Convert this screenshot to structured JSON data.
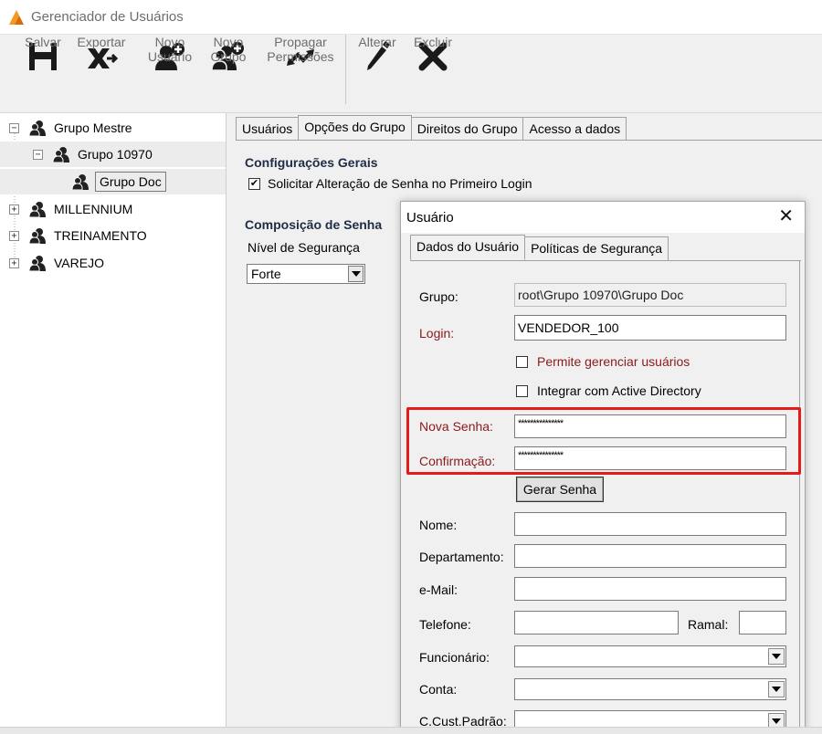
{
  "window": {
    "title": "Gerenciador de Usuários"
  },
  "toolbar": {
    "buttons": [
      {
        "label": "Salvar",
        "icon": "save-icon"
      },
      {
        "label": "Exportar",
        "icon": "export-icon"
      },
      {
        "label": "Novo\nUsuário",
        "icon": "new-user-icon"
      },
      {
        "label": "Novo\nGrupo",
        "icon": "new-group-icon"
      },
      {
        "label": "Propagar\nPermissões",
        "icon": "propagate-icon"
      },
      {
        "label": "Alterar",
        "icon": "edit-pencil-icon"
      },
      {
        "label": "Excluir",
        "icon": "delete-x-icon"
      }
    ]
  },
  "tree": {
    "items": [
      {
        "label": "Grupo Mestre",
        "expander": "−"
      },
      {
        "label": "Grupo 10970",
        "expander": "−"
      },
      {
        "label": "Grupo Doc",
        "expander": ""
      },
      {
        "label": "MILLENNIUM",
        "expander": "+"
      },
      {
        "label": "TREINAMENTO",
        "expander": "+"
      },
      {
        "label": "VAREJO",
        "expander": "+"
      }
    ]
  },
  "main": {
    "tabs": [
      {
        "label": "Usuários"
      },
      {
        "label": "Opções do Grupo"
      },
      {
        "label": "Direitos do Grupo"
      },
      {
        "label": "Acesso a dados"
      }
    ],
    "general_title": "Configurações Gerais",
    "require_password_change": {
      "label": "Solicitar Alteração de Senha no Primeiro Login",
      "checked": true,
      "mark": "✔"
    },
    "composition_title": "Composição de Senha",
    "security_level_label": "Nível de Segurança",
    "security_level_value": "Forte"
  },
  "dialog": {
    "title": "Usuário",
    "close": "✕",
    "tabs": [
      {
        "label": "Dados do Usuário"
      },
      {
        "label": "Políticas de Segurança"
      }
    ],
    "group": {
      "label": "Grupo:",
      "value": "root\\Grupo 10970\\Grupo Doc"
    },
    "login": {
      "label": "Login:",
      "value": "VENDEDOR_100"
    },
    "allow_manage_users": {
      "label": "Permite gerenciar usuários",
      "checked": false
    },
    "integrate_ad": {
      "label": "Integrar com Active Directory",
      "checked": false
    },
    "new_password": {
      "label": "Nova Senha:",
      "value": "***************"
    },
    "confirmation": {
      "label": "Confirmação:",
      "value": "***************"
    },
    "generate_password_button": "Gerar Senha",
    "name": {
      "label": "Nome:",
      "value": ""
    },
    "department": {
      "label": "Departamento:",
      "value": ""
    },
    "email": {
      "label": "e-Mail:",
      "value": ""
    },
    "phone": {
      "label": "Telefone:",
      "value": ""
    },
    "extension": {
      "label": "Ramal:",
      "value": ""
    },
    "employee": {
      "label": "Funcionário:",
      "value": ""
    },
    "account": {
      "label": "Conta:",
      "value": ""
    },
    "cost_center": {
      "label": "C.Cust.Padrão:",
      "value": ""
    }
  },
  "colors": {
    "highlight": "#e41b1b",
    "required_label": "#8b1a1a",
    "section_title": "#1e2c44"
  }
}
